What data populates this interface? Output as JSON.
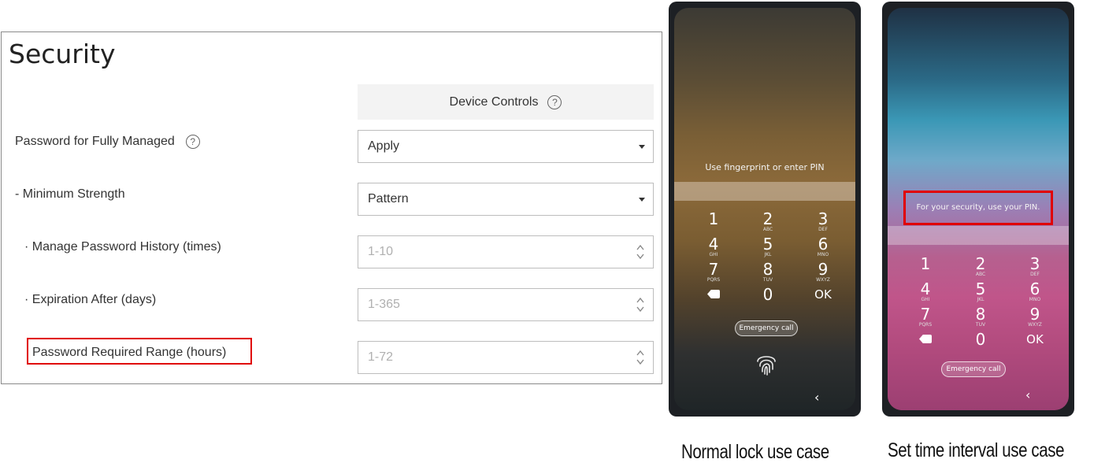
{
  "security": {
    "title": "Security",
    "column_header": "Device Controls",
    "rows": [
      {
        "label": "Password for Fully Managed",
        "value": "Apply",
        "kind": "select"
      },
      {
        "label": "- Minimum Strength",
        "value": "Pattern",
        "kind": "select"
      },
      {
        "label": "· Manage Password History (times)",
        "placeholder": "1-10",
        "kind": "number"
      },
      {
        "label": "· Expiration After (days)",
        "placeholder": "1-365",
        "kind": "number"
      },
      {
        "label": "Password Required Range (hours)",
        "placeholder": "1-72",
        "kind": "number"
      }
    ],
    "highlight_color": "#e00000"
  },
  "phone_normal": {
    "prompt": "Use fingerprint or enter PIN",
    "keys": [
      {
        "num": "1",
        "sub": ""
      },
      {
        "num": "2",
        "sub": "ABC"
      },
      {
        "num": "3",
        "sub": "DEF"
      },
      {
        "num": "4",
        "sub": "GHI"
      },
      {
        "num": "5",
        "sub": "JKL"
      },
      {
        "num": "6",
        "sub": "MNO"
      },
      {
        "num": "7",
        "sub": "PQRS"
      },
      {
        "num": "8",
        "sub": "TUV"
      },
      {
        "num": "9",
        "sub": "WXYZ"
      },
      {
        "num": "",
        "sub": ""
      },
      {
        "num": "0",
        "sub": ""
      },
      {
        "num": "OK",
        "sub": ""
      }
    ],
    "emergency_label": "Emergency call",
    "back_glyph": "‹"
  },
  "phone_interval": {
    "prompt": "For your security, use your PIN.",
    "keys": [
      {
        "num": "1",
        "sub": ""
      },
      {
        "num": "2",
        "sub": "ABC"
      },
      {
        "num": "3",
        "sub": "DEF"
      },
      {
        "num": "4",
        "sub": "GHI"
      },
      {
        "num": "5",
        "sub": "JKL"
      },
      {
        "num": "6",
        "sub": "MNO"
      },
      {
        "num": "7",
        "sub": "PQRS"
      },
      {
        "num": "8",
        "sub": "TUV"
      },
      {
        "num": "9",
        "sub": "WXYZ"
      },
      {
        "num": "",
        "sub": ""
      },
      {
        "num": "0",
        "sub": ""
      },
      {
        "num": "OK",
        "sub": ""
      }
    ],
    "emergency_label": "Emergency call",
    "back_glyph": "‹"
  },
  "captions": {
    "normal": "Normal lock use case",
    "interval": "Set time interval use case"
  }
}
